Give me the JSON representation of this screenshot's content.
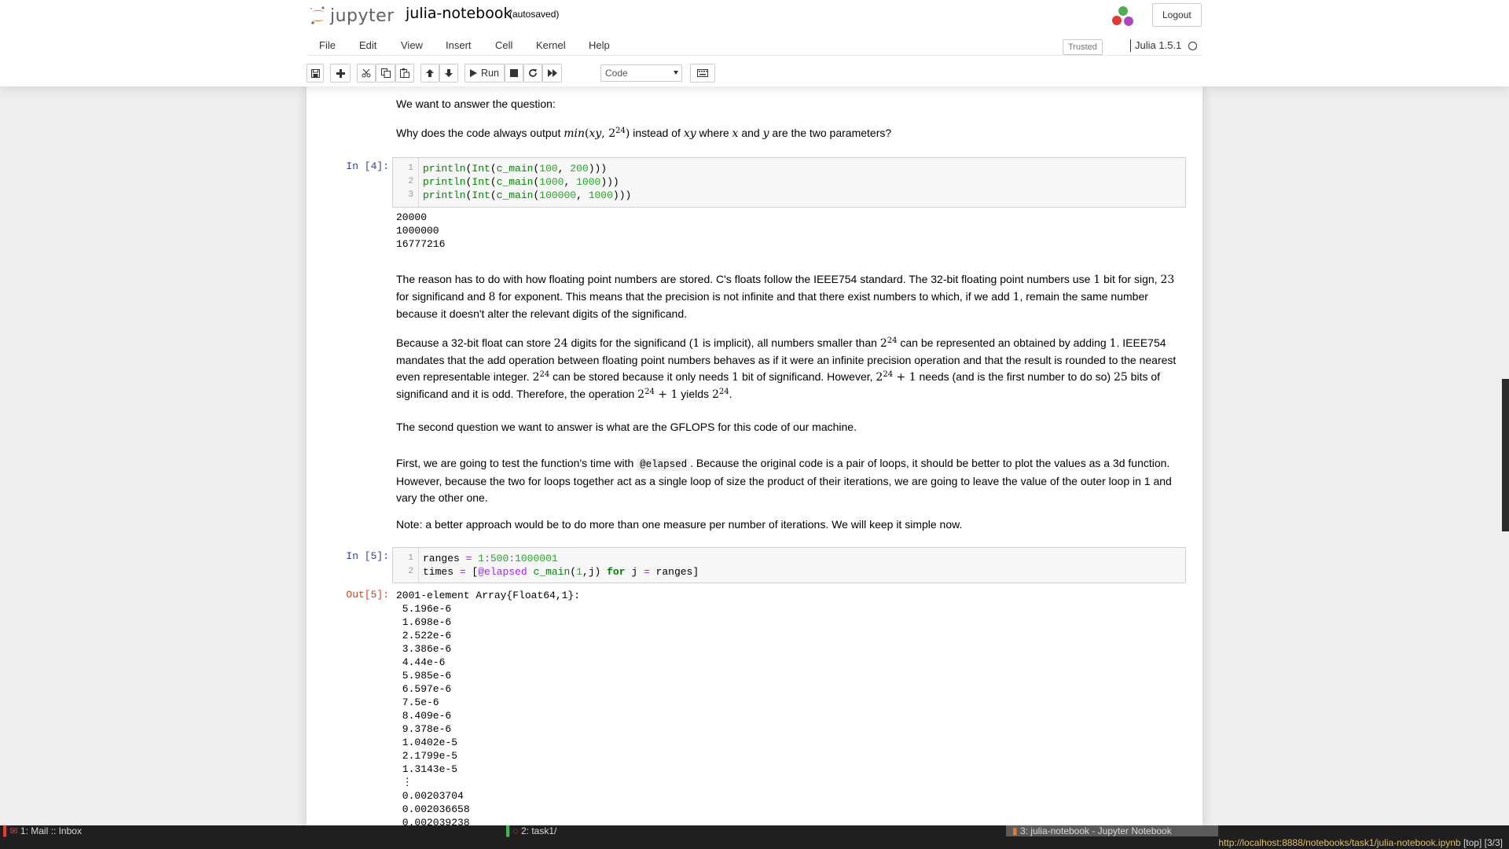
{
  "header": {
    "logo_text": "jupyter",
    "notebook_name": "julia-notebook",
    "save_status": "(autosaved)",
    "logout_label": "Logout"
  },
  "menu": {
    "file": "File",
    "edit": "Edit",
    "view": "View",
    "insert": "Insert",
    "cell": "Cell",
    "kernel": "Kernel",
    "help": "Help",
    "trusted": "Trusted",
    "kernel_name": "Julia 1.5.1"
  },
  "toolbar": {
    "run_label": "Run",
    "cell_type": "Code"
  },
  "cells": {
    "md1": {
      "p1": "We want to answer the question:",
      "p2_a": "Why does the code always output ",
      "p2_b": " instead of ",
      "p2_c": " where ",
      "p2_d": " and ",
      "p2_e": " are the two parameters?"
    },
    "in4": {
      "prompt": "In [4]:",
      "lines": [
        "println(Int(c_main(100, 200)))",
        "println(Int(c_main(1000, 1000)))",
        "println(Int(c_main(100000, 1000)))"
      ],
      "output": "20000\n1000000\n16777216"
    },
    "md2": {
      "p1": "The reason has to do with how floating point numbers are stored. C's floats follow the IEEE754 standard. The 32-bit floating point numbers use 1 bit for sign, 23 for significand and 8 for exponent. This means that the precision is not infinite and that there exist numbers to which, if we add 1, remain the same number because it doesn't alter the relevant digits of the significand.",
      "p2": "Because a 32-bit float can store 24 digits for the significand (1 is implicit), all numbers smaller than 2^24 can be represented an obtained by adding 1. IEEE754 mandates that the add operation between floating point numbers behaves as if it were an infinite precision operation and that the result is rounded to the nearest even representable integer. 2^24 can be stored because it only needs 1 bit of significand. However, 2^24 + 1 needs (and is the first number to do so) 25 bits of significand and it is odd. Therefore, the operation 2^24 + 1 yields 2^24."
    },
    "md3": {
      "p1": "The second question we want to answer is what are the GFLOPS for this code of our machine."
    },
    "md4": {
      "p1_a": "First, we are going to test the function's time with ",
      "p1_code": "@elapsed",
      "p1_b": ". Because the original code is a pair of loops, it should be better to plot the values as a 3d function. However, because the two for loops together act as a single loop of size the product of their iterations, we are going to leave the value of the outer loop in 1 and vary the other one.",
      "p2": "Note: a better approach would be to do more than one measure per number of iterations. We will keep it simple now."
    },
    "in5": {
      "prompt": "In [5]:",
      "out_prompt": "Out[5]:",
      "lines": [
        "ranges = 1:500:1000001",
        "times = [@elapsed c_main(1,j) for j = ranges]"
      ],
      "output": "2001-element Array{Float64,1}:\n 5.196e-6\n 1.698e-6\n 2.522e-6\n 3.386e-6\n 4.44e-6\n 5.985e-6\n 6.597e-6\n 7.5e-6\n 8.409e-6\n 9.378e-6\n 1.0402e-5\n 2.1799e-5\n 1.3143e-5\n ⋮\n 0.00203704\n 0.002036658\n 0.002039238"
    }
  },
  "taskbar": {
    "task1": "1: Mail :: Inbox",
    "task2": "2: task1/",
    "task3": "3: julia-notebook - Jupyter Notebook",
    "url": "http://localhost:8888/notebooks/task1/julia-notebook.ipynb",
    "position": "[top]",
    "pages": "[3/3]"
  },
  "colors": {
    "jupyter_orange": "#f37726",
    "in_prompt": "#303f9f",
    "out_prompt": "#d84315"
  }
}
